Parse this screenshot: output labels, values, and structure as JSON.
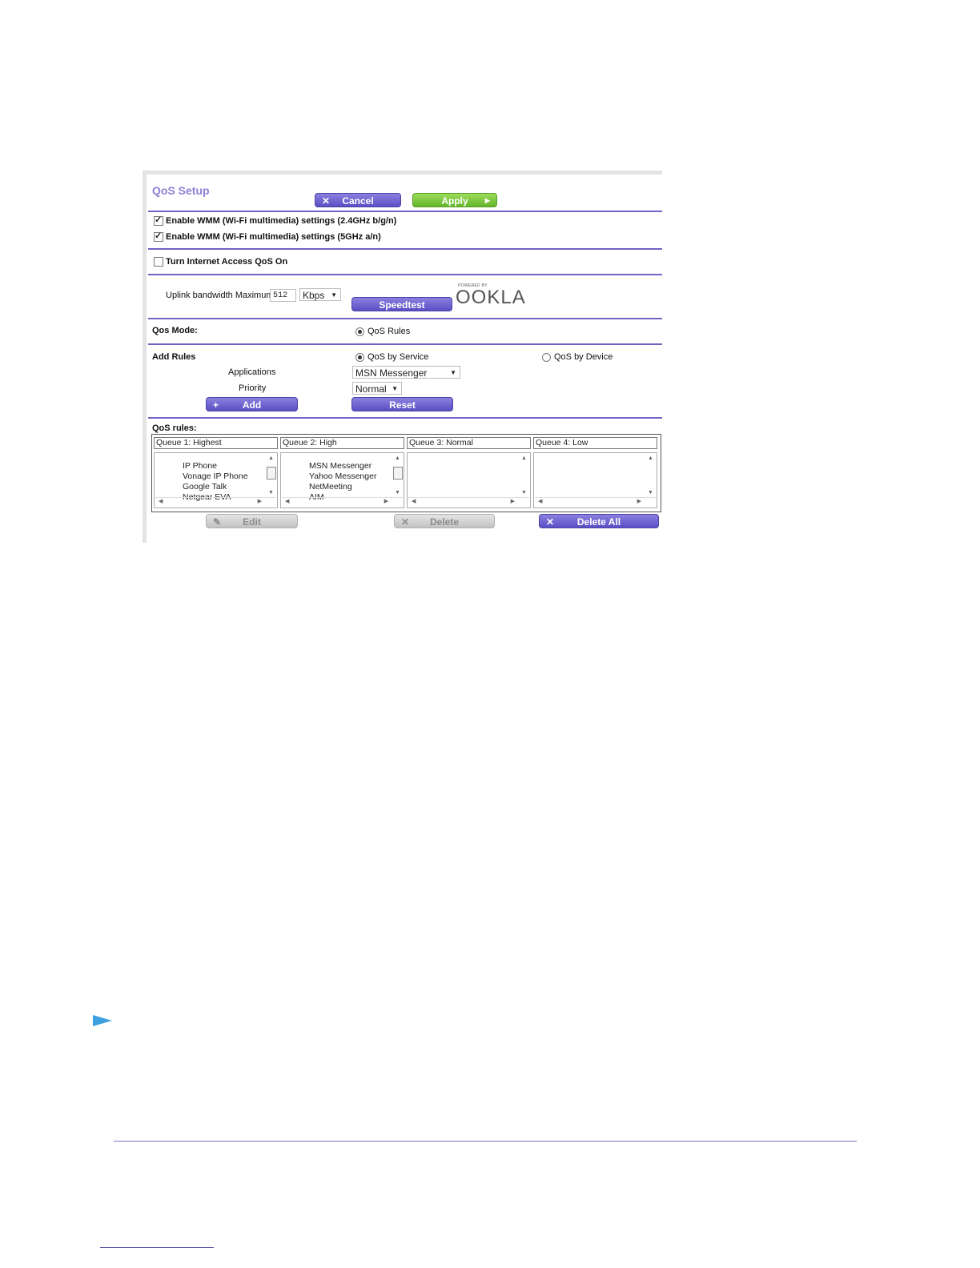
{
  "title": "QoS Setup",
  "toolbar": {
    "cancel_label": "Cancel",
    "apply_label": "Apply"
  },
  "wmm": {
    "wmm_24_label": "Enable WMM (Wi-Fi multimedia) settings (2.4GHz b/g/n)",
    "wmm_24_checked": true,
    "wmm_5_label": "Enable WMM (Wi-Fi multimedia) settings (5GHz a/n)",
    "wmm_5_checked": true
  },
  "internet_qos": {
    "label": "Turn Internet Access QoS On",
    "checked": false
  },
  "uplink": {
    "label": "Uplink bandwidth Maximum",
    "value": "512",
    "unit": "Kbps",
    "speedtest_label": "Speedtest",
    "powered_by": "POWERED BY",
    "ookla": "OOKLA"
  },
  "qos_mode": {
    "label": "Qos Mode:",
    "option": "QoS Rules"
  },
  "add_rules": {
    "label": "Add Rules",
    "by_service": "QoS by Service",
    "by_device": "QoS by Device",
    "applications_label": "Applications",
    "applications_value": "MSN Messenger",
    "priority_label": "Priority",
    "priority_value": "Normal",
    "add_label": "Add",
    "reset_label": "Reset"
  },
  "qos_rules": {
    "label": "QoS rules:",
    "queues": [
      {
        "header": "Queue 1: Highest",
        "items": [
          "IP Phone",
          "Vonage IP Phone",
          "Google Talk",
          "Netgear EVA"
        ]
      },
      {
        "header": "Queue 2: High",
        "items": [
          "MSN Messenger",
          "Yahoo Messenger",
          "NetMeeting",
          "AIM"
        ]
      },
      {
        "header": "Queue 3: Normal",
        "items": []
      },
      {
        "header": "Queue 4: Low",
        "items": []
      }
    ],
    "edit_label": "Edit",
    "delete_label": "Delete",
    "delete_all_label": "Delete All"
  },
  "colors": {
    "accent": "#6e64c4",
    "apply_green": "#7cc63f",
    "bullet_blue": "#3fa0e0"
  }
}
